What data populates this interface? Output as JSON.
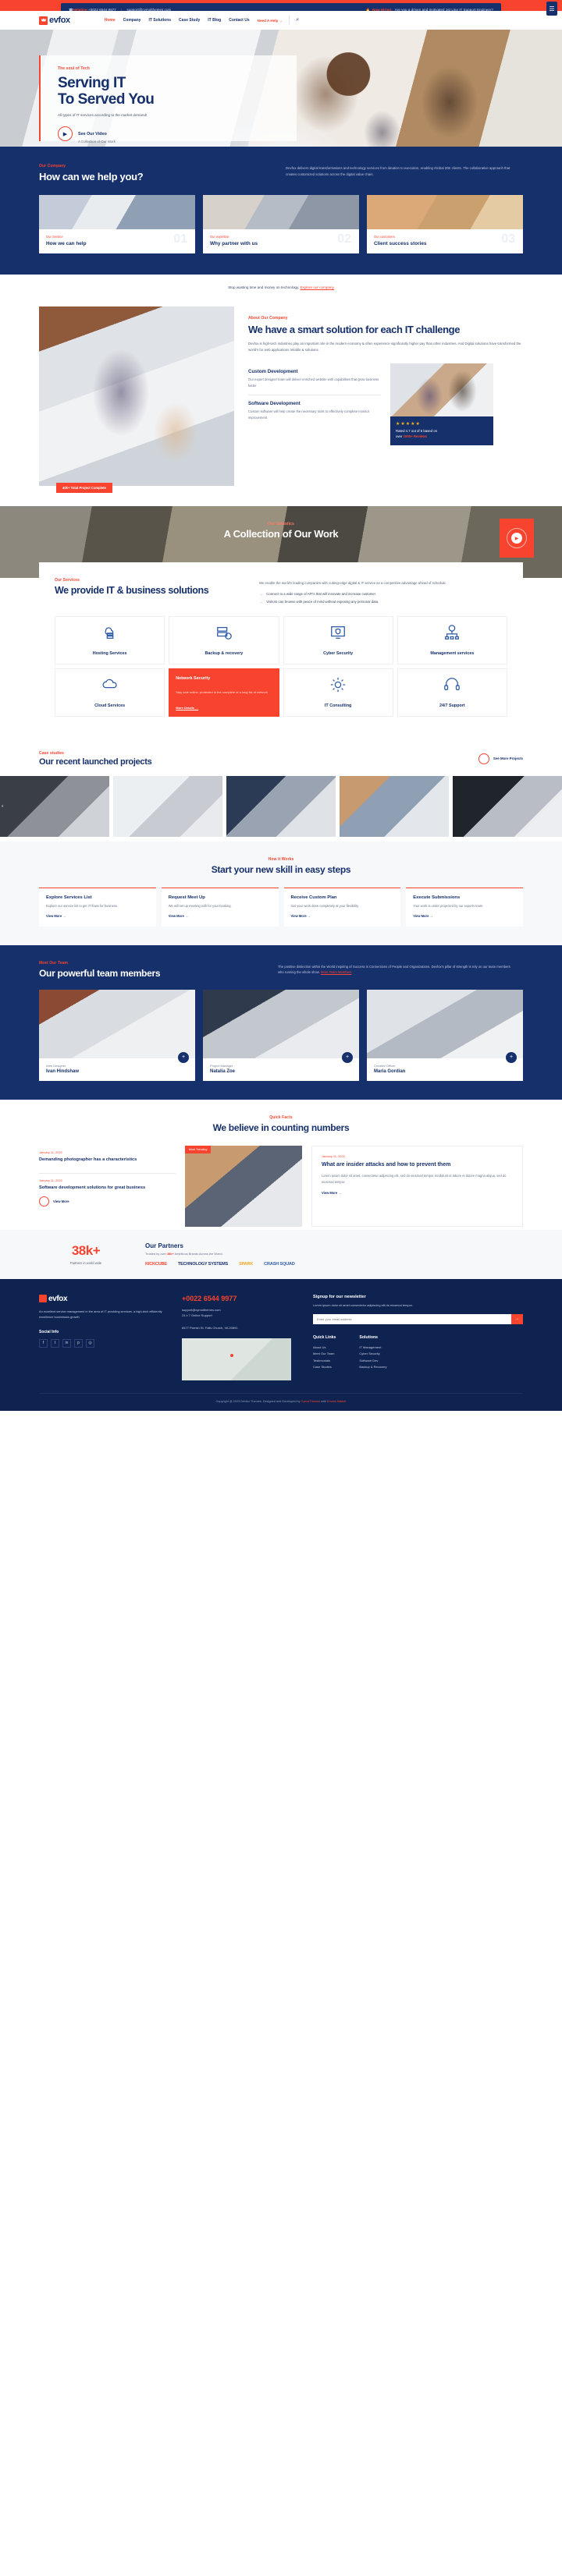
{
  "topbar": {
    "helpline_label": "Helpline:",
    "phone": "+0022 6544 9977",
    "email": "support@cymolthemes.com",
    "hiring_label": "Now Hiring:",
    "hiring_text": "Are you a driven and motivated 1st Line IT Support Engineer?",
    "menu_icon": "☰"
  },
  "brand": {
    "name": "evfox"
  },
  "nav": {
    "items": [
      "Home",
      "Company",
      "IT Solutions",
      "Case Study",
      "IT Blog",
      "Contact Us"
    ],
    "active": "Home",
    "cta": "Need A Help →",
    "search_icon": "⌕"
  },
  "hero": {
    "eyebrow": "The soul of Tech",
    "title_line1": "Serving IT",
    "title_line2": "To Served You",
    "subtitle": "All types of IT services according to the market demand!",
    "video_title": "See Our Video",
    "video_sub": "A Collection of Our Work",
    "play_icon": "▶"
  },
  "help": {
    "eyebrow": "Our Company",
    "title": "How can we help you?",
    "paragraph": "Devfox delivers digital transformations and technology services from ideation to execution, enabling Global 20K clients. The collaborative approach that creates customized solutions across the digital value chain.",
    "cards": [
      {
        "label": "Our Service",
        "title": "How we can help",
        "num": "01"
      },
      {
        "label": "Our expertise",
        "title": "Why partner with us",
        "num": "02"
      },
      {
        "label": "Our customers",
        "title": "Client success stories",
        "num": "03"
      }
    ],
    "footnote": "Stop wasting time and money on technology.",
    "footnote_link": "Explore our company"
  },
  "about": {
    "badge": "40k+ Total Project Complete",
    "eyebrow": "About Our Company",
    "title": "We have a smart solution for each IT challenge",
    "lead": "Devfox is high-tech industries play an important role in the modern economy & often experience significantly higher pay than other industries. And Digital solutions have transformed the world's for web applications reliable & solutions.",
    "features": [
      {
        "title": "Custom Development",
        "text": "Our expert designer team will deliver enriched website with capabilities that grow business faster"
      },
      {
        "title": "Software Development",
        "text": "Custom software will help create the necessary tools to effectively complete monitor improvement"
      }
    ],
    "review": {
      "stars": "★★★★★",
      "line1": "Rated 4.7 out of 5 based on",
      "over": "over ",
      "count": "1000+ Reviews"
    }
  },
  "collection": {
    "eyebrow": "Our Statistics",
    "title": "A Collection of Our Work",
    "play_icon": "▶"
  },
  "services": {
    "eyebrow": "Our Services",
    "title": "We provide IT & business solutions",
    "paragraph": "We enable the world's leading companies with cutting-edge digital & IT service as a competitive advantage ahead of schedule.",
    "bullets": [
      "Connect to a wide range of API's that will innovate and increase customer",
      "Visitors can browse with peace of mind without exposing any personal data."
    ],
    "items": [
      {
        "name": "Hosting Services",
        "icon": "cloud-server-icon"
      },
      {
        "name": "Backup & recovery",
        "icon": "database-refresh-icon"
      },
      {
        "name": "Cyber Security",
        "icon": "monitor-shield-icon"
      },
      {
        "name": "Management services",
        "icon": "org-chart-icon"
      },
      {
        "name": "Cloud Services",
        "icon": "cloud-icon"
      },
      {
        "name": "Network Security",
        "icon": "network-icon",
        "active": true,
        "text": "Stay safe online, protected to the complete of a long list of network",
        "more": "More Details →"
      },
      {
        "name": "IT Consulting",
        "icon": "gear-people-icon"
      },
      {
        "name": "24/7 Support",
        "icon": "headset-icon"
      }
    ]
  },
  "projects": {
    "eyebrow": "Case studies",
    "title": "Our recent launched projects",
    "see_more": "See More Projects",
    "prev_icon": "‹"
  },
  "steps": {
    "eyebrow": "How it Works",
    "title": "Start your new skill in easy steps",
    "items": [
      {
        "title": "Explore Services List",
        "text": "Explore our service list to get IT flows for business.",
        "link": "View More →"
      },
      {
        "title": "Request Meet Up",
        "text": "We will set up meeting with for your booking.",
        "link": "View More →"
      },
      {
        "title": "Receive Custom Plan",
        "text": "Get your work done completely at your flexibility.",
        "link": "View More →"
      },
      {
        "title": "Execute Submissions",
        "text": "Your work is under projected by our experts team.",
        "link": "View More →"
      }
    ]
  },
  "team": {
    "eyebrow": "Meet Our Team",
    "title": "Our powerful team members",
    "paragraph": "The positive distinction within the World inspiring of Success is Connections of People and Organizations. Devfox's pillar of strength is rely on our team members who running the whole show.",
    "paragraph_link": "More Team Members",
    "members": [
      {
        "role": "Web Designer",
        "name": "Ivan Hindshaw",
        "plus": "+"
      },
      {
        "role": "Project Manager",
        "name": "Natalia Zoe",
        "plus": "+"
      },
      {
        "role": "Creative Officer",
        "name": "Maria Gordian",
        "plus": "+"
      }
    ]
  },
  "counting": {
    "eyebrow": "Quick Facts",
    "title": "We believe in counting numbers",
    "posts": [
      {
        "date": "January 11, 2022",
        "title": "Demanding photographer has a characteristics"
      },
      {
        "date": "January 11, 2022",
        "title": "Software development solutions for great business"
      }
    ],
    "view_more": "View More",
    "featured": {
      "tag": "Most Trending",
      "date": "January 11, 2022",
      "title": "What are insider attacks and how to prevent them",
      "text": "Lorem ipsum dolor sit amet, consectetur adipiscing elit, sed do eiusmod tempor incididunt ut labore et dolore magna aliqua. sed do eiusmod tempor.",
      "link": "View More →"
    }
  },
  "partners": {
    "number": "38k+",
    "caption": "Partners in world wide",
    "title": "Our Partners",
    "subtitle_pre": "Trusted by over ",
    "subtitle_count": "38k+",
    "subtitle_post": " Ambitious Brands Across the World.",
    "logos": [
      "KICKCUBE",
      "TECHNOLOGY SYSTEMS",
      "SPARK",
      "CRASH SQUAD"
    ]
  },
  "footer": {
    "brand": "evfox",
    "about": "An excellent service management in the area of IT providing services. a high-tech efficiently excellence businesses growth",
    "social_title": "Social Info",
    "socials": [
      "f",
      "t",
      "in",
      "p",
      "◎"
    ],
    "phone": "+0022 6544 9977",
    "email": "support@cymolthemes.com",
    "address_line1": "24 x 7 Online Support",
    "address_line2": "8477 Parrish St. Falls Church, VA 20891",
    "newsletter_title": "Signup for our newsletter",
    "newsletter_text": "Lorem ipsum dolor sit amet consectetur adipiscing elit do eiusmod tempor.",
    "newsletter_placeholder": "Enter your email address",
    "newsletter_button": "→",
    "quick_links_title": "Quick Links",
    "quick_links": [
      "About Us",
      "Meet Our Team",
      "Testimonials",
      "Case Studies"
    ],
    "solutions_title": "Solutions",
    "solutions": [
      "IT Management",
      "Cyber Security",
      "Software Dev",
      "Backup & Recovery"
    ],
    "copyright_pre": "Copyright @ 2023 Devfox Themes. Designed and Developed by ",
    "copyright_link1": "CymolThemes",
    "copyright_mid": " with ",
    "copyright_link2": "Envato Market"
  }
}
